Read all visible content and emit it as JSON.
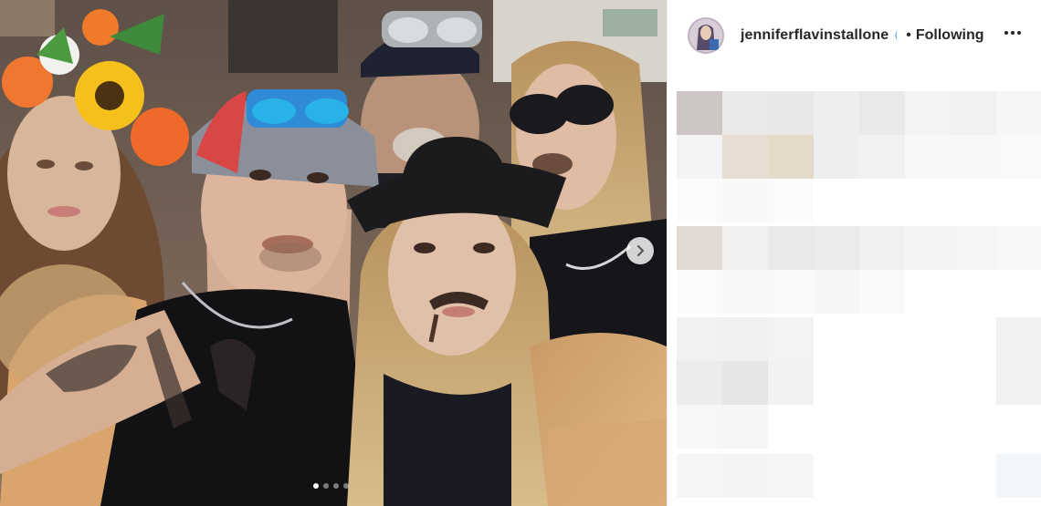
{
  "post": {
    "username": "jenniferflavinstallone",
    "separator": "•",
    "follow_label": "Following",
    "photo_description_icon": "group-selfie-photo",
    "carousel": {
      "total_slides": 4,
      "active_slide": 1
    },
    "colors": {
      "text": "#262626",
      "verified": "#3897f0",
      "pixel_block_dark": "#cbc5c3",
      "pixel_block_beige": "#e5ddd3"
    }
  }
}
